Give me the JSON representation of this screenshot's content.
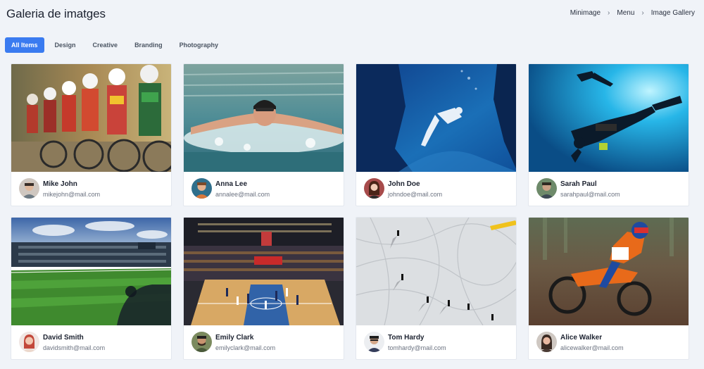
{
  "header": {
    "title": "Galeria de imatges",
    "breadcrumb": [
      "Minimage",
      "Menu",
      "Image Gallery"
    ]
  },
  "filters": [
    "All Items",
    "Design",
    "Creative",
    "Branding",
    "Photography"
  ],
  "active_filter": "All Items",
  "cards": [
    {
      "photo": "cycling-race-photo",
      "name": "Mike John",
      "email": "mikejohn@mail.com"
    },
    {
      "photo": "swimmer-photo",
      "name": "Anna Lee",
      "email": "annalee@mail.com"
    },
    {
      "photo": "freediver-photo",
      "name": "John Doe",
      "email": "johndoe@mail.com"
    },
    {
      "photo": "scuba-diver-photo",
      "name": "Sarah Paul",
      "email": "sarahpaul@mail.com"
    },
    {
      "photo": "football-stadium-photo",
      "name": "David Smith",
      "email": "davidsmith@mail.com"
    },
    {
      "photo": "basketball-arena-photo",
      "name": "Emily Clark",
      "email": "emilyclark@mail.com"
    },
    {
      "photo": "skiers-on-slope-photo",
      "name": "Tom Hardy",
      "email": "tomhardy@mail.com"
    },
    {
      "photo": "motocross-rider-photo",
      "name": "Alice Walker",
      "email": "alicewalker@mail.com"
    }
  ]
}
